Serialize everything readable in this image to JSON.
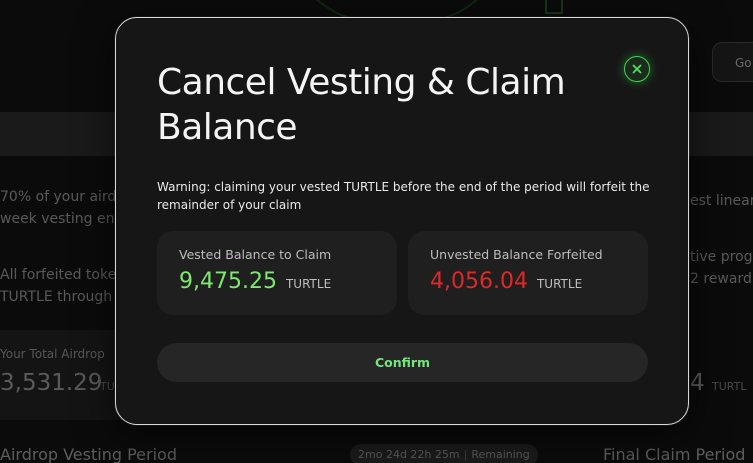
{
  "background": {
    "top_right_button_label": "Go",
    "left_texts": [
      "70% of your aird",
      "week vesting end",
      "All forfeited toke",
      "TURTLE through"
    ],
    "right_texts": [
      "est linear",
      "tive prog",
      "2 reward"
    ],
    "airdrop_label": "Your Total Airdrop",
    "airdrop_value": "3,531.29",
    "airdrop_unit": "TUR",
    "right_value": "4",
    "right_unit": "TURTL",
    "vesting_title": "Airdrop Vesting Period",
    "vesting_timer": "2mo 24d 22h 25m",
    "vesting_timer_status": "Remaining",
    "final_title": "Final Claim Period"
  },
  "modal": {
    "title": "Cancel Vesting & Claim Balance",
    "close_icon": "close-icon",
    "warning": "Warning: claiming your vested TURTLE before the end of the period will forfeit the remainder of your claim",
    "vested": {
      "label": "Vested Balance to Claim",
      "amount": "9,475.25",
      "unit": "TURTLE",
      "color": "#7ee86f"
    },
    "unvested": {
      "label": "Unvested Balance Forfeited",
      "amount": "4,056.04",
      "unit": "TURTLE",
      "color": "#e02828"
    },
    "confirm_label": "Confirm",
    "accent_color": "#3fd34a"
  }
}
